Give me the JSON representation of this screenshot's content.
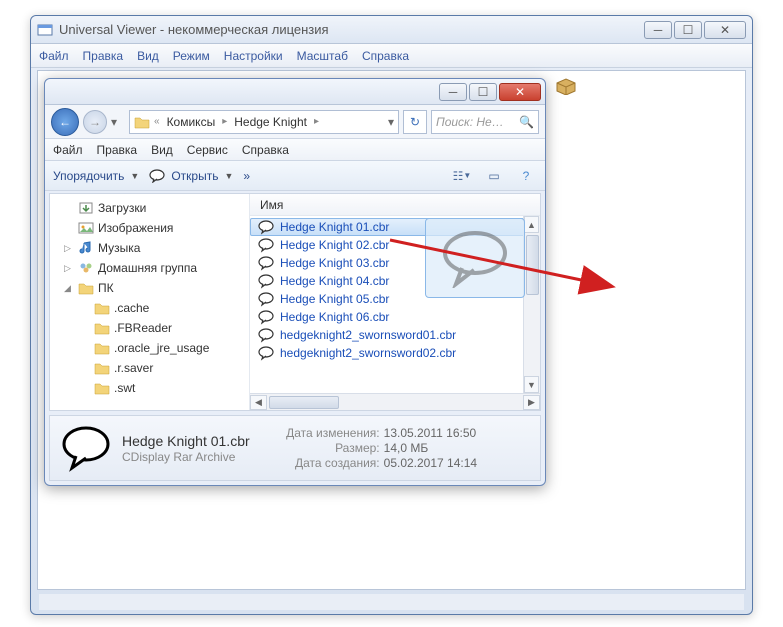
{
  "outer": {
    "title": "Universal Viewer - некоммерческая лицензия",
    "menu": [
      "Файл",
      "Правка",
      "Вид",
      "Режим",
      "Настройки",
      "Масштаб",
      "Справка"
    ]
  },
  "explorer": {
    "breadcrumb": {
      "root_sep": "«",
      "item1": "Комиксы",
      "item2": "Hedge Knight"
    },
    "search_placeholder": "Поиск: He…",
    "menu": [
      "Файл",
      "Правка",
      "Вид",
      "Сервис",
      "Справка"
    ],
    "toolbar": {
      "organize": "Упорядочить",
      "open": "Открыть",
      "more": "»"
    },
    "column_header": "Имя",
    "tree": [
      {
        "label": "Загрузки",
        "icon": "downloads",
        "lvl": 0
      },
      {
        "label": "Изображения",
        "icon": "pictures",
        "lvl": 0
      },
      {
        "label": "Музыка",
        "icon": "music",
        "lvl": 0,
        "tri": "▷"
      },
      {
        "label": "Домашняя группа",
        "icon": "homegroup",
        "lvl": 0,
        "tri": "▷"
      },
      {
        "label": "ПК",
        "icon": "folder",
        "lvl": 0,
        "tri": "◢"
      },
      {
        "label": ".cache",
        "icon": "folder",
        "lvl": 1
      },
      {
        "label": ".FBReader",
        "icon": "folder",
        "lvl": 1
      },
      {
        "label": ".oracle_jre_usage",
        "icon": "folder",
        "lvl": 1
      },
      {
        "label": ".r.saver",
        "icon": "folder",
        "lvl": 1
      },
      {
        "label": ".swt",
        "icon": "folder",
        "lvl": 1
      }
    ],
    "files": [
      {
        "name": "Hedge Knight 01.cbr",
        "selected": true
      },
      {
        "name": "Hedge Knight 02.cbr"
      },
      {
        "name": "Hedge Knight 03.cbr"
      },
      {
        "name": "Hedge Knight 04.cbr"
      },
      {
        "name": "Hedge Knight 05.cbr"
      },
      {
        "name": "Hedge Knight 06.cbr"
      },
      {
        "name": "hedgeknight2_swornsword01.cbr"
      },
      {
        "name": "hedgeknight2_swornsword02.cbr"
      }
    ],
    "details": {
      "filename": "Hedge Knight 01.cbr",
      "filetype": "CDisplay Rar Archive",
      "mod_label": "Дата изменения:",
      "mod_value": "13.05.2011 16:50",
      "size_label": "Размер:",
      "size_value": "14,0 МБ",
      "created_label": "Дата создания:",
      "created_value": "05.02.2017 14:14"
    }
  }
}
